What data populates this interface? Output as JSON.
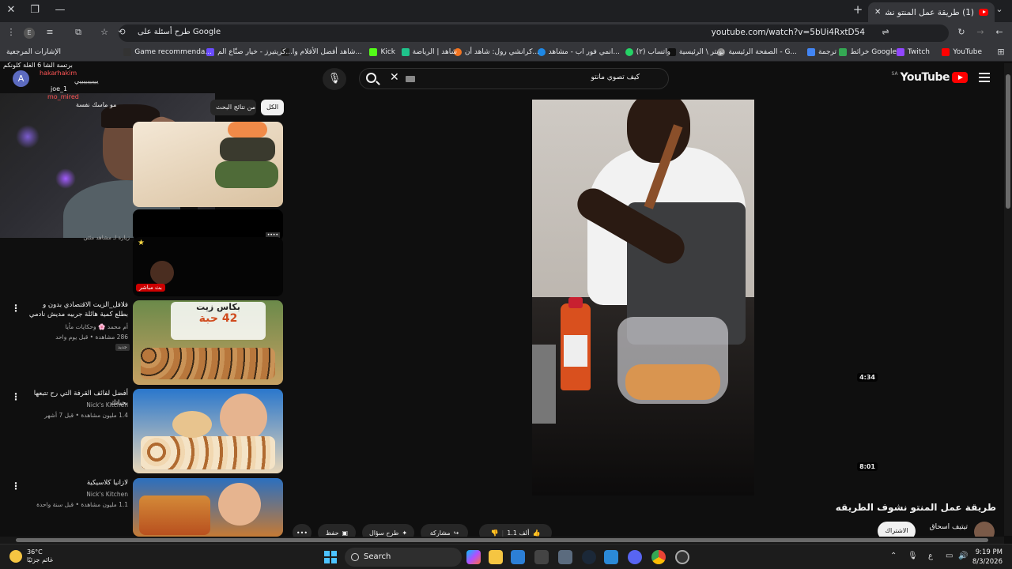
{
  "browser": {
    "tab": {
      "title": "(1) طريقة عمل المنتو نشوف الطر",
      "close": "✕"
    },
    "new_tab": "+",
    "window_controls": {
      "minimize": "—",
      "restore": "❐",
      "close": "✕"
    },
    "url": "youtube.com/watch?v=5bUi4RxtD54",
    "omnibox_action": "طرح أسئلة على Google",
    "bookmarks": [
      {
        "label": "YouTube",
        "color": "#ff0000"
      },
      {
        "label": "Twitch",
        "color": "#9146ff"
      },
      {
        "label": "خرائط Google",
        "color": "#34a853"
      },
      {
        "label": "ترجمة",
        "color": "#4285f4"
      },
      {
        "label": "الصفحة الرئيسية - G...",
        "color": "#888888"
      },
      {
        "label": "تويتر \\ الرئيسية",
        "color": "#111111"
      },
      {
        "label": "(٢) واتساب",
        "color": "#25d366"
      },
      {
        "label": "انمي فور اب - مشاهد...",
        "color": "#1e88e5"
      },
      {
        "label": "كرانشي رول: شاهد أن...",
        "color": "#f47521"
      },
      {
        "label": "شاهد | الرياضة",
        "color": "#1fc38b"
      },
      {
        "label": "Kick",
        "color": "#53fc18"
      },
      {
        "label": "شاهد أفضل الأفلام وا...",
        "color": "#222222"
      },
      {
        "label": "كريتيرز - خيار صنّاع الم...",
        "color": "#6a4cff"
      },
      {
        "label": "Game recommenda...",
        "color": "#333333"
      },
      {
        "label": "الإشارات المرجعية",
        "color": "#cccccc"
      }
    ]
  },
  "youtube": {
    "logo": "YouTube",
    "country": "SA",
    "search_query": "كيف تصوي مانتو",
    "avatar_letter": "A",
    "chips": [
      "الكل",
      "من نتائج البحث"
    ],
    "video": {
      "title": "طريقة عمل المنتو نشوف الطريقه",
      "channel": "تيتيف اسحاق",
      "subscribe": "الاشتراك",
      "likes": "1.1 ألف",
      "actions": [
        "مشاركة",
        "طرح سؤال",
        "حفظ"
      ]
    },
    "related": [
      {
        "title": "",
        "meta1": "زيارة لـ مشاهد مئتي",
        "meta2": "",
        "duration": "",
        "badge": "بث مباشر"
      },
      {
        "title": "فلافل_الزيت الاقتصادي بدون و بطلع كمية هائلة جربيه مديش نادمي",
        "channel": "أم محمد 🌸 وحكايات مأيا",
        "meta2": "286 مشاهدة • قبل يوم واحد",
        "tag": "جديد",
        "duration": "4:34",
        "thumb_text1": "بكاس زيت",
        "thumb_text2": "42 حبة"
      },
      {
        "title": "أفضل لفائف القرفة التي رح تتبعها بحياتك",
        "channel": "Nick's Kitchen",
        "meta2": "1.4 مليون مشاهدة • قبل 7 أشهر",
        "duration": "8:01"
      },
      {
        "title": "لازانيا كلاسيكية",
        "channel": "Nick's Kitchen",
        "meta2": "1.1 مليون مشاهدة • قبل سنة واحدة",
        "duration": ""
      }
    ]
  },
  "webcam_chat": [
    "برتسة الشا 6 الغلة كلونكم",
    "hakarhakim",
    "ييييييييييي",
    "joe_1",
    "mo_mired",
    "مو ماسك نفسة"
  ],
  "taskbar": {
    "weather_temp": "36°C",
    "weather_desc": "غائم جزئيًا",
    "search": "Search",
    "time": "9:19 PM",
    "date": "8/3/2026",
    "lang": "ع"
  },
  "colors": {
    "brand": "#ff0000",
    "background": "#0f0f0f"
  }
}
